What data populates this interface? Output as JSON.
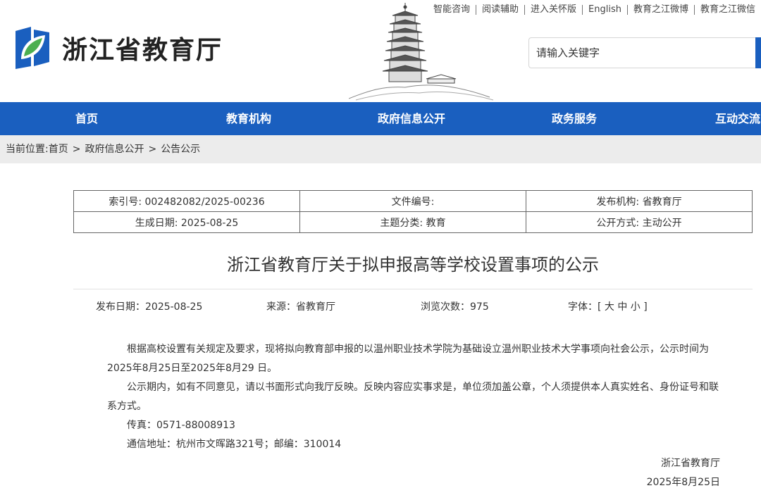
{
  "header": {
    "site_name": "浙江省教育厅",
    "top_links": [
      "智能咨询",
      "阅读辅助",
      "进入关怀版",
      "English",
      "教育之江微博",
      "教育之江微信"
    ],
    "search_placeholder": "请输入关键字"
  },
  "nav": {
    "items": [
      "首页",
      "教育机构",
      "政府信息公开",
      "政务服务",
      "互动交流"
    ]
  },
  "breadcrumb": {
    "prefix": "当前位置:",
    "items": [
      "首页",
      "政府信息公开",
      "公告公示"
    ],
    "separator": ">"
  },
  "info_table": {
    "rows": [
      [
        "索引号: 002482082/2025-00236",
        "文件编号:",
        "发布机构: 省教育厅"
      ],
      [
        "生成日期: 2025-08-25",
        "主题分类: 教育",
        "公开方式: 主动公开"
      ]
    ]
  },
  "article": {
    "title": "浙江省教育厅关于拟申报高等学校设置事项的公示",
    "publish_date": "发布日期：2025-08-25",
    "source": "来源：省教育厅",
    "views": "浏览次数：975",
    "font_size": "字体：[ 大 中 小 ]",
    "paragraphs": [
      "根据高校设置有关规定及要求，现将拟向教育部申报的以温州职业技术学院为基础设立温州职业技术大学事项向社会公示，公示时间为2025年8月25日至2025年8月29 日。",
      "公示期内，如有不同意见，请以书面形式向我厅反映。反映内容应实事求是，单位须加盖公章，个人须提供本人真实姓名、身份证号和联系方式。",
      "传真：0571-88008913",
      "通信地址：杭州市文晖路321号；邮编：310014"
    ],
    "signature": "浙江省教育厅",
    "sign_date": "2025年8月25日"
  },
  "colors": {
    "nav_bg": "#1a5fbf",
    "breadcrumb_bg": "#ececec",
    "logo_blue": "#1a5fbf",
    "logo_green": "#4caf50"
  }
}
